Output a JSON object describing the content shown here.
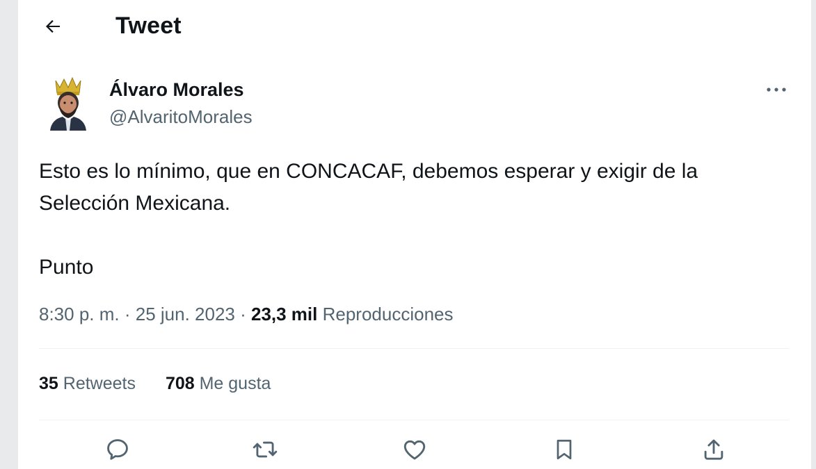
{
  "header": {
    "title": "Tweet",
    "back_icon": "arrow-left-icon"
  },
  "author": {
    "name": "Álvaro Morales",
    "handle": "@AlvaritoMorales",
    "avatar": "crowned-man-avatar"
  },
  "more_icon": "ellipsis-icon",
  "tweet": {
    "line1": "Esto es lo mínimo, que en CONCACAF, debemos esperar y exigir de la",
    "line2": "Selección Mexicana.",
    "line3": "Punto"
  },
  "meta": {
    "time": "8:30 p. m.",
    "sep1": " · ",
    "date": "25 jun. 2023",
    "sep2": " · ",
    "views_count": "23,3 mil",
    "views_label": " Reproducciones"
  },
  "stats": {
    "retweets_count": "35",
    "retweets_label": " Retweets",
    "likes_count": "708",
    "likes_label": " Me gusta"
  },
  "actions": [
    "reply-icon",
    "retweet-icon",
    "like-icon",
    "bookmark-icon",
    "share-icon"
  ],
  "colors": {
    "text_primary": "#0f1419",
    "text_secondary": "#536471",
    "divider": "#eff3f4",
    "background": "#ffffff"
  }
}
